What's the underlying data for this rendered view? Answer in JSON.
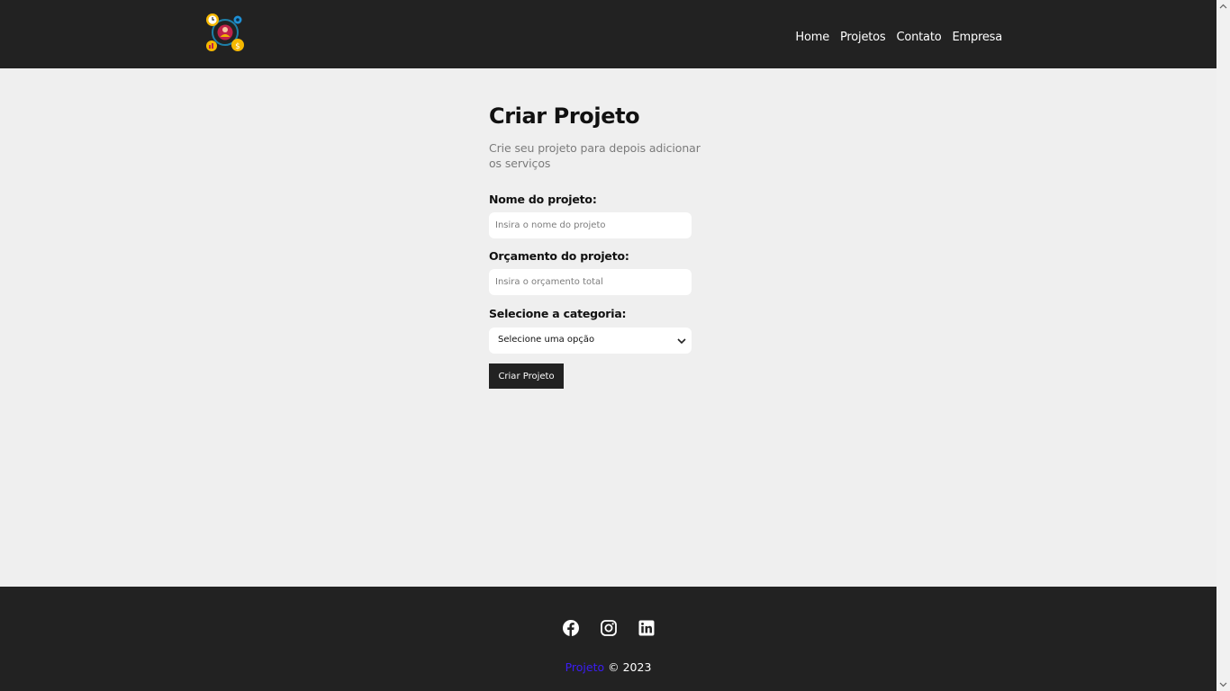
{
  "header": {
    "nav": [
      {
        "label": "Home"
      },
      {
        "label": "Projetos"
      },
      {
        "label": "Contato"
      },
      {
        "label": "Empresa"
      }
    ]
  },
  "main": {
    "title": "Criar Projeto",
    "subtitle": "Crie seu projeto para depois adicionar os serviços",
    "form": {
      "name_label": "Nome do projeto:",
      "name_placeholder": "Insira o nome do projeto",
      "budget_label": "Orçamento do projeto:",
      "budget_placeholder": "Insira o orçamento total",
      "category_label": "Selecione a categoria:",
      "category_selected": "Selecione uma opção",
      "submit_label": "Criar Projeto"
    }
  },
  "footer": {
    "social_icons": [
      "facebook-icon",
      "instagram-icon",
      "linkedin-icon"
    ],
    "brand": "Projeto",
    "copyright": "© 2023"
  },
  "colors": {
    "navbar_bg": "#222222",
    "page_bg": "#efefef",
    "brand_accent": "#3b1df5"
  }
}
